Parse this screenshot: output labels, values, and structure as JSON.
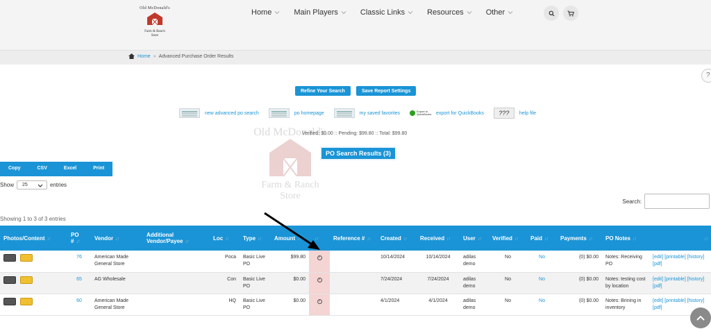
{
  "logo": {
    "line1": "Old McDonald's",
    "line2": "Farm & Ranch",
    "line3": "Store"
  },
  "nav": [
    {
      "label": "Home"
    },
    {
      "label": "Main Players"
    },
    {
      "label": "Classic Links"
    },
    {
      "label": "Resources"
    },
    {
      "label": "Other"
    }
  ],
  "breadcrumb": {
    "home": "Home",
    "separator": "»",
    "current": "Advanced Purchase Order Results"
  },
  "help_mark": "?",
  "buttons": {
    "refine": "Refine Your Search",
    "save": "Save Report Settings"
  },
  "links": [
    {
      "label": "new advanced po search"
    },
    {
      "label": "po homepage"
    },
    {
      "label": "my saved favorites"
    },
    {
      "label": "export for QuickBooks",
      "badge": "Export to QuickBooks"
    },
    {
      "label": "help file",
      "badge": "???"
    }
  ],
  "watermark": {
    "line1": "Old McDonald's",
    "line2": "Farm & Ranch",
    "line3": "Store"
  },
  "totals": "Verified: $0.00 :: Pending: $99.80 :: Total: $99.80",
  "results_title": "PO Search Results (3)",
  "export_buttons": [
    "Copy",
    "CSV",
    "Excel",
    "Print"
  ],
  "length_menu": {
    "prefix": "Show",
    "value": "25",
    "suffix": "entries"
  },
  "search": {
    "label": "Search:"
  },
  "info": "Showing 1 to 3 of 3 entries",
  "columns": [
    "Photos/Content",
    "PO #",
    "Vendor",
    "Additional Vendor/Payee",
    "Loc",
    "Type",
    "Amount",
    "",
    "Reference #",
    "Created",
    "Received",
    "User",
    "Verified",
    "Paid",
    "Payments",
    "PO Notes",
    ""
  ],
  "rows": [
    {
      "po": "76",
      "vendor": "American Made General Store",
      "additional": "",
      "loc": "Poca",
      "type": "Basic Live PO",
      "amount": "$99.80",
      "reference": "",
      "created": "10/14/2024",
      "received": "10/14/2024",
      "user": "adilas demo",
      "verified": "No",
      "paid": "No",
      "payments": "(0) $0.00",
      "notes": "Notes: Receiving PO",
      "actions": "[edit] [printable] [history] [pdf]"
    },
    {
      "po": "65",
      "vendor": "AG Wholesale",
      "additional": "",
      "loc": "Con",
      "type": "Basic Live PO",
      "amount": "$0.00",
      "reference": "",
      "created": "7/24/2024",
      "received": "7/24/2024",
      "user": "adilas demo",
      "verified": "No",
      "paid": "No",
      "payments": "(0) $0.00",
      "notes": "Notes: testing cost by location",
      "actions": "[edit] [printable] [history] [pdf]"
    },
    {
      "po": "60",
      "vendor": "American Made General Store",
      "additional": "",
      "loc": "HQ",
      "type": "Basic Live PO",
      "amount": "$0.00",
      "reference": "",
      "created": "4/1/2024",
      "received": "4/1/2024",
      "user": "adilas demo",
      "verified": "No",
      "paid": "No",
      "payments": "(0) $0.00",
      "notes": "Notes: Brining in inventory",
      "actions": "[edit] [printable] [history] [pdf]"
    }
  ],
  "colors": {
    "accent": "#1a94d6",
    "highlight": "#f5d4d4"
  }
}
